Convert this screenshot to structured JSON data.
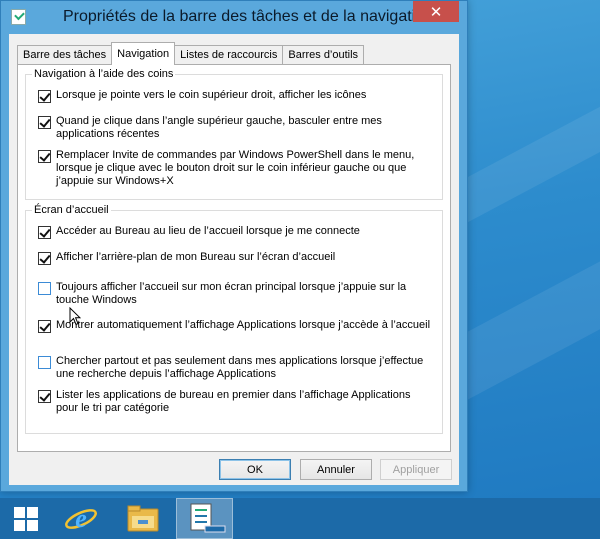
{
  "window": {
    "title": "Propriétés de la barre des tâches et de la navigation",
    "close_glyph": "✕"
  },
  "tabs": [
    {
      "label": "Barre des tâches",
      "active": false
    },
    {
      "label": "Navigation",
      "active": true
    },
    {
      "label": "Listes de raccourcis",
      "active": false
    },
    {
      "label": "Barres d’outils",
      "active": false
    }
  ],
  "groups": {
    "corners": {
      "legend": "Navigation à l’aide des coins",
      "options": [
        {
          "label": "Lorsque je pointe vers le coin supérieur droit, afficher les icônes",
          "checked": true
        },
        {
          "label": "Quand je clique dans l’angle supérieur gauche, basculer entre mes applications récentes",
          "checked": true
        },
        {
          "label": "Remplacer Invite de commandes par Windows PowerShell dans le menu, lorsque je clique avec le bouton droit sur le coin inférieur gauche ou que j’appuie sur Windows+X",
          "checked": true
        }
      ]
    },
    "start": {
      "legend": "Écran d’accueil",
      "options": [
        {
          "label": "Accéder au Bureau au lieu de l’accueil lorsque je me connecte",
          "checked": true
        },
        {
          "label": "Afficher l’arrière-plan de mon Bureau sur l’écran d’accueil",
          "checked": true
        },
        {
          "label": "Toujours afficher l’accueil sur mon écran principal lorsque j’appuie sur la touche Windows",
          "checked": false
        },
        {
          "label": "Montrer automatiquement l’affichage Applications lorsque j’accède à l’accueil",
          "checked": true
        },
        {
          "label": "Chercher partout et pas seulement dans mes applications lorsque j’effectue une recherche depuis l’affichage Applications",
          "checked": false
        },
        {
          "label": "Lister les applications de bureau en premier dans l’affichage Applications pour le tri par catégorie",
          "checked": true
        }
      ]
    }
  },
  "buttons": {
    "ok": "OK",
    "cancel": "Annuler",
    "apply": "Appliquer"
  },
  "taskbar": {
    "items": [
      {
        "icon": "windows-start-icon"
      },
      {
        "icon": "internet-explorer-icon"
      },
      {
        "icon": "file-explorer-icon"
      },
      {
        "icon": "taskbar-properties-icon",
        "active": true
      }
    ]
  },
  "colors": {
    "window_frame": "#5aa8dc",
    "close_button": "#c7504b",
    "taskbar": "#1c6aa8",
    "desktop": "#2d8ccd"
  }
}
